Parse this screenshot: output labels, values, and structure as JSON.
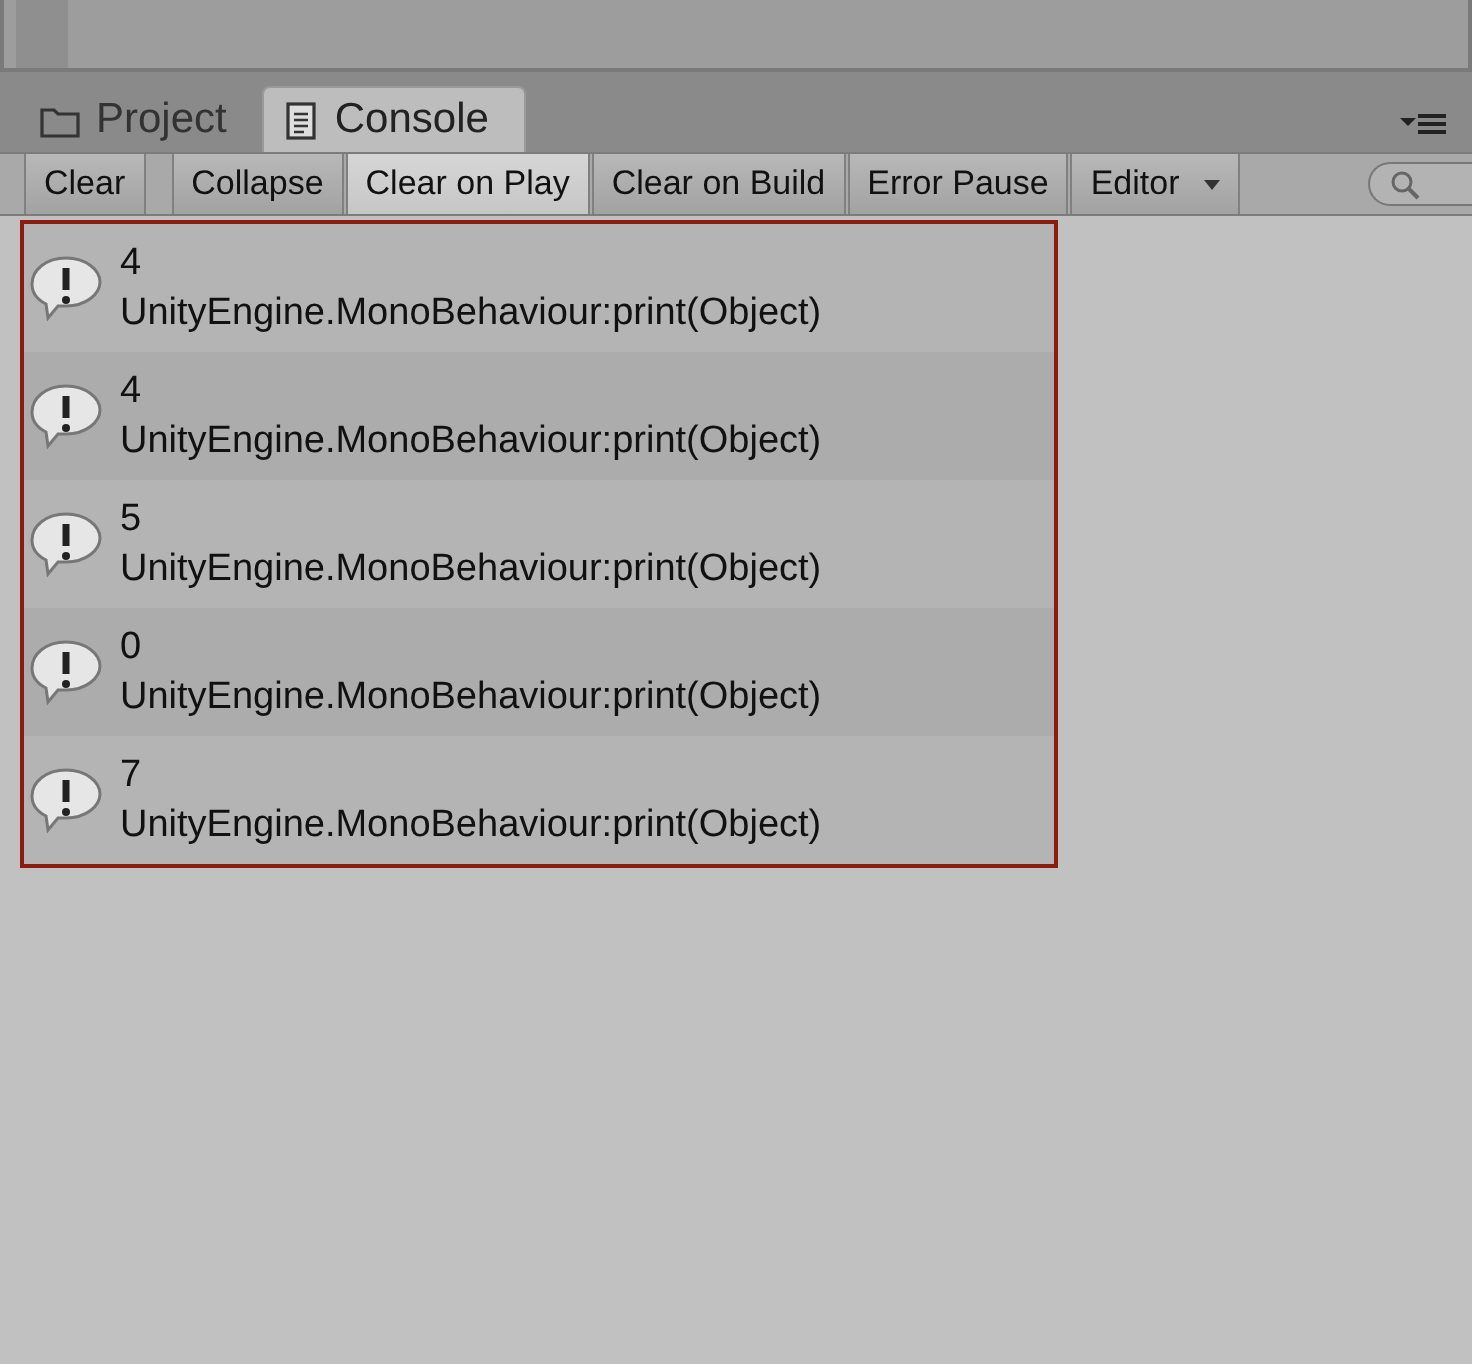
{
  "tabs": [
    {
      "label": "Project",
      "selected": false
    },
    {
      "label": "Console",
      "selected": true
    }
  ],
  "toolbar": [
    {
      "label": "Clear",
      "kind": "button"
    },
    {
      "label": "Collapse",
      "kind": "toggle",
      "on": false
    },
    {
      "label": "Clear on Play",
      "kind": "toggle",
      "on": true
    },
    {
      "label": "Clear on Build",
      "kind": "toggle",
      "on": false
    },
    {
      "label": "Error Pause",
      "kind": "toggle",
      "on": false
    },
    {
      "label": "Editor",
      "kind": "dropdown"
    }
  ],
  "log": [
    {
      "message": "4",
      "source": "UnityEngine.MonoBehaviour:print(Object)"
    },
    {
      "message": "4",
      "source": "UnityEngine.MonoBehaviour:print(Object)"
    },
    {
      "message": "5",
      "source": "UnityEngine.MonoBehaviour:print(Object)"
    },
    {
      "message": "0",
      "source": "UnityEngine.MonoBehaviour:print(Object)"
    },
    {
      "message": "7",
      "source": "UnityEngine.MonoBehaviour:print(Object)"
    }
  ]
}
